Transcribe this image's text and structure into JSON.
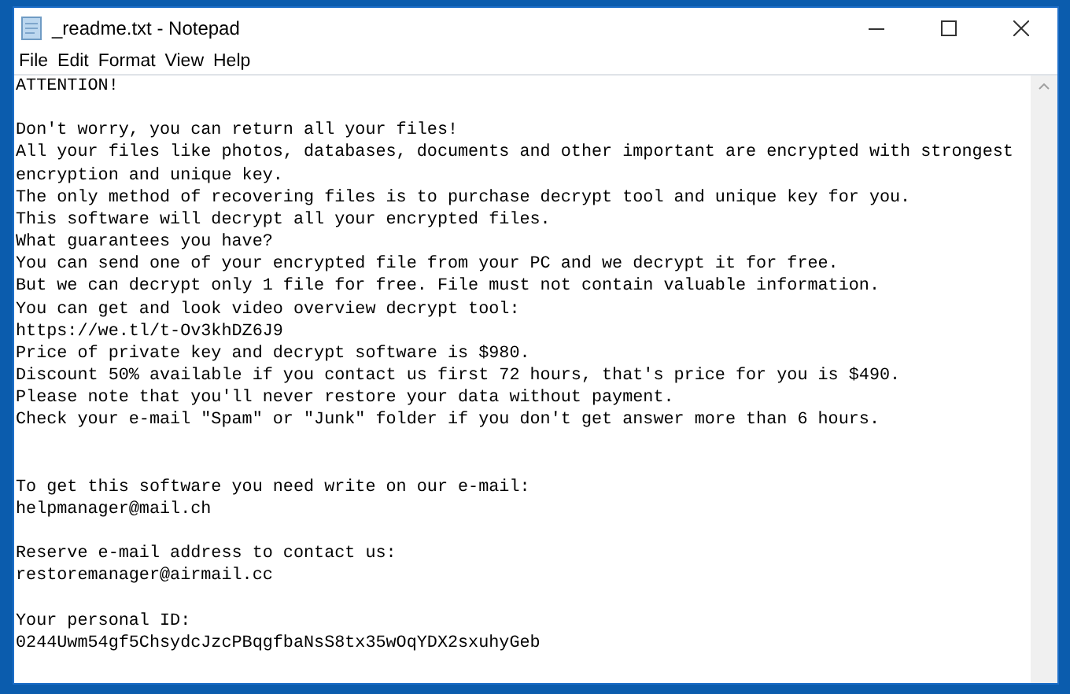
{
  "window": {
    "title": "_readme.txt - Notepad"
  },
  "menu": [
    "File",
    "Edit",
    "Format",
    "View",
    "Help"
  ],
  "document": {
    "text": "ATTENTION!\n\nDon't worry, you can return all your files!\nAll your files like photos, databases, documents and other important are encrypted with strongest\nencryption and unique key.\nThe only method of recovering files is to purchase decrypt tool and unique key for you.\nThis software will decrypt all your encrypted files.\nWhat guarantees you have?\nYou can send one of your encrypted file from your PC and we decrypt it for free.\nBut we can decrypt only 1 file for free. File must not contain valuable information.\nYou can get and look video overview decrypt tool:\nhttps://we.tl/t-Ov3khDZ6J9\nPrice of private key and decrypt software is $980.\nDiscount 50% available if you contact us first 72 hours, that's price for you is $490.\nPlease note that you'll never restore your data without payment.\nCheck your e-mail \"Spam\" or \"Junk\" folder if you don't get answer more than 6 hours.\n\n\nTo get this software you need write on our e-mail:\nhelpmanager@mail.ch\n\nReserve e-mail address to contact us:\nrestoremanager@airmail.cc\n\nYour personal ID:\n0244Uwm54gf5ChsydcJzcPBqgfbaNsS8tx35wOqYDX2sxuhyGeb"
  }
}
